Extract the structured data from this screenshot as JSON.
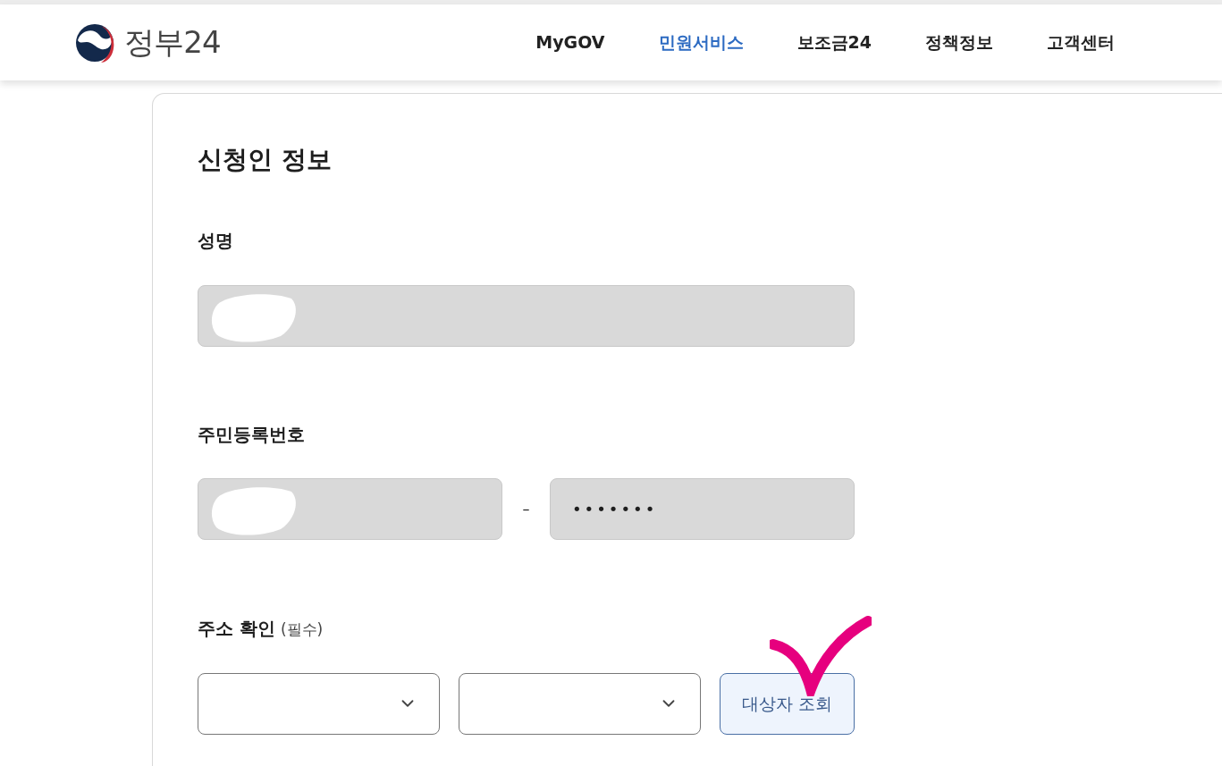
{
  "header": {
    "logo_text": "정부24",
    "nav": [
      {
        "label": "MyGOV",
        "selected": false
      },
      {
        "label": "민원서비스",
        "selected": true
      },
      {
        "label": "보조금24",
        "selected": false
      },
      {
        "label": "정책정보",
        "selected": false
      },
      {
        "label": "고객센터",
        "selected": false
      }
    ]
  },
  "form": {
    "title": "신청인 정보",
    "name_field": {
      "label": "성명",
      "redacted": true
    },
    "resident_number": {
      "label": "주민등록번호",
      "front_redacted": true,
      "separator": "–",
      "back_value": "•••••••"
    },
    "address": {
      "label": "주소 확인",
      "required_note": "(필수)",
      "button": "대상자 조회",
      "annotated": true
    }
  }
}
